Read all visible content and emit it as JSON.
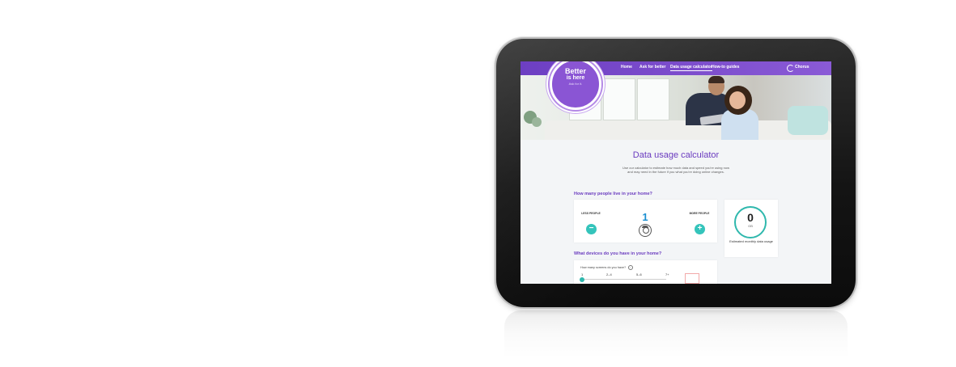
{
  "nav": {
    "badge": {
      "line1": "Better",
      "line2": "is here",
      "line3": "Ask for it."
    },
    "items": [
      {
        "label": "Home"
      },
      {
        "label": "Ask for better"
      },
      {
        "label": "Data usage calculator"
      },
      {
        "label": "How-to guides"
      }
    ],
    "active_index": 2,
    "brand": "Chorus"
  },
  "page": {
    "title": "Data usage calculator",
    "intro_line1": "Use our calculator to estimate how much data and speed you're using now",
    "intro_line2": "and may need in the future if you what you're doing online changes."
  },
  "people": {
    "question": "How many people live in your home?",
    "less_label": "LESS PEOPLE",
    "more_label": "MORE PEOPLE",
    "minus": "−",
    "plus": "+",
    "count": "1"
  },
  "usage": {
    "value": "0",
    "unit": "GB",
    "label": "Estimated monthly data usage"
  },
  "devices": {
    "question": "What devices do you have in your home?",
    "sub_question": "How many screens do you have?",
    "info": "i",
    "ticks": [
      "1",
      "2–4",
      "5–6",
      "7+"
    ],
    "selected": "1"
  },
  "colors": {
    "brand_purple": "#6d3fc2",
    "accent_teal": "#34c4bb",
    "count_blue": "#1a8fd1"
  }
}
